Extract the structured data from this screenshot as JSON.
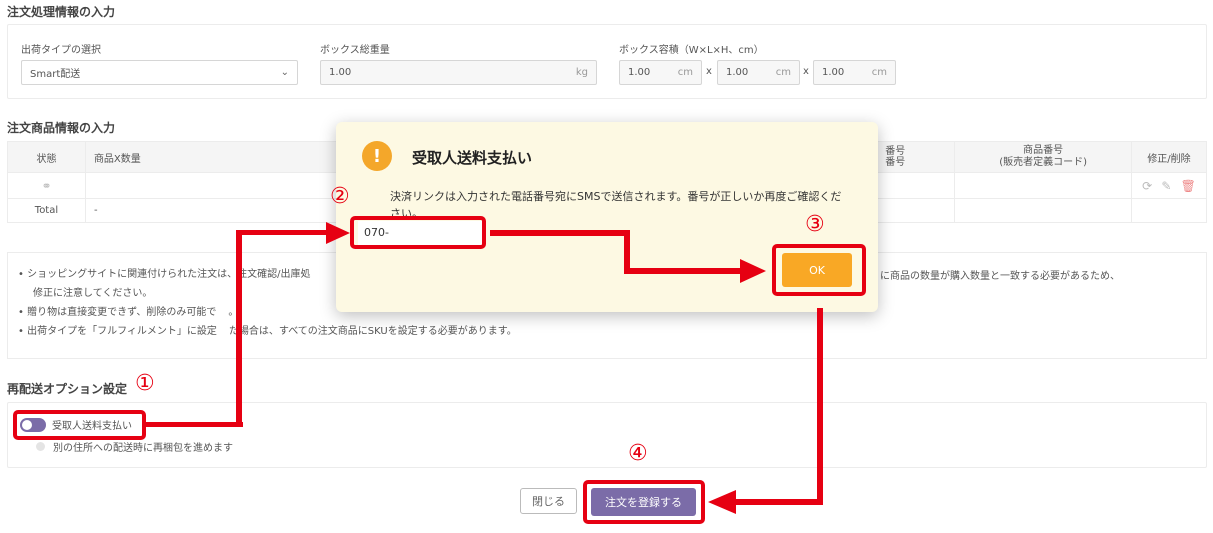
{
  "order_section": {
    "title": "注文処理情報の入力",
    "shipping_type_label": "出荷タイプの選択",
    "shipping_type_value": "Smart配送",
    "box_weight_label": "ボックス総重量",
    "box_weight_value": "1.00",
    "box_weight_unit": "kg",
    "box_volume_label": "ボックス容積（W×L×H、cm）",
    "box_w": "1.00",
    "box_l": "1.00",
    "box_h": "1.00",
    "cm_unit": "cm",
    "x_sep": "x"
  },
  "items_section": {
    "title": "注文商品情報の入力",
    "columns": {
      "status": "状態",
      "product_qty": "商品X数量",
      "seller_code_line1": "商品番号",
      "seller_code_line2": "(販売者定義コード)",
      "edit_delete": "修正/削除",
      "partial_a": "番号",
      "partial_b": "番号"
    },
    "total_label": "Total",
    "total_value": "-"
  },
  "notes": {
    "line1": "• ショッピングサイトに関連付けられた注文は、注文確認/出庫処",
    "line1_right": "に商品の数量が購入数量と一致する必要があるため、",
    "line1b": "修正に注意してください。",
    "line2": "• 贈り物は直接変更できず、削除のみ可能で",
    "line2_tail": "。",
    "line3": "• 出荷タイプを「フルフィルメント」に設定",
    "line3_tail": "た場合は、すべての注文商品にSKUを設定する必要があります。"
  },
  "redelivery": {
    "title": "再配送オプション設定",
    "toggle_label": "受取人送料支払い",
    "option2_label": "別の住所への配送時に再梱包を進めます"
  },
  "buttons": {
    "close": "閉じる",
    "submit": "注文を登録する"
  },
  "dialog": {
    "icon": "!",
    "title": "受取人送料支払い",
    "message": "決済リンクは入力された電話番号宛にSMSで送信されます。番号が正しいか再度ご確認ください。",
    "phone_value": "070-",
    "ok": "OK"
  },
  "annotations": {
    "n1": "①",
    "n2": "②",
    "n3": "③",
    "n4": "④"
  },
  "colors": {
    "accent": "#7b6ca8",
    "warning": "#f4a72a",
    "ok_button": "#f9a825",
    "annotation_red": "#e60012",
    "dialog_bg": "#fdf9e3"
  }
}
